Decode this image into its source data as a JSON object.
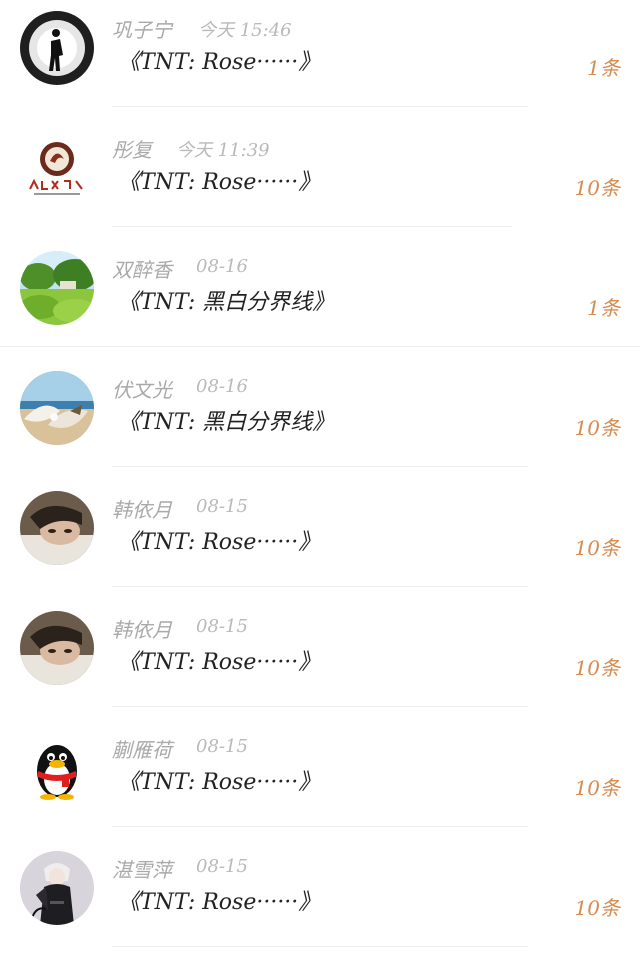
{
  "colors": {
    "name": "#a9a9a9",
    "time": "#b9b9b9",
    "title": "#222222",
    "count": "#d88a4c",
    "divider": "#ececec"
  },
  "messages": [
    {
      "name": "巩子宁",
      "time": "今天 15:46",
      "title": "《TNT: Rose······》",
      "count": "1条",
      "avatar": "silhouette-avatar"
    },
    {
      "name": "彤复",
      "time": "今天 11:39",
      "title": "《TNT: Rose······》",
      "count": "10条",
      "avatar": "logo-avatar"
    },
    {
      "name": "双醉香",
      "time": "08-16",
      "title": "《TNT: 黑白分界线》",
      "count": "1条",
      "avatar": "landscape-avatar"
    },
    {
      "name": "伏文光",
      "time": "08-16",
      "title": "《TNT: 黑白分界线》",
      "count": "10条",
      "avatar": "shell-avatar"
    },
    {
      "name": "韩依月",
      "time": "08-15",
      "title": "《TNT: Rose······》",
      "count": "10条",
      "avatar": "portrait-avatar"
    },
    {
      "name": "韩依月",
      "time": "08-15",
      "title": "《TNT: Rose······》",
      "count": "10条",
      "avatar": "portrait-avatar"
    },
    {
      "name": "蒯雁荷",
      "time": "08-15",
      "title": "《TNT: Rose······》",
      "count": "10条",
      "avatar": "penguin-avatar"
    },
    {
      "name": "湛雪萍",
      "time": "08-15",
      "title": "《TNT: Rose······》",
      "count": "10条",
      "avatar": "character-avatar"
    }
  ]
}
